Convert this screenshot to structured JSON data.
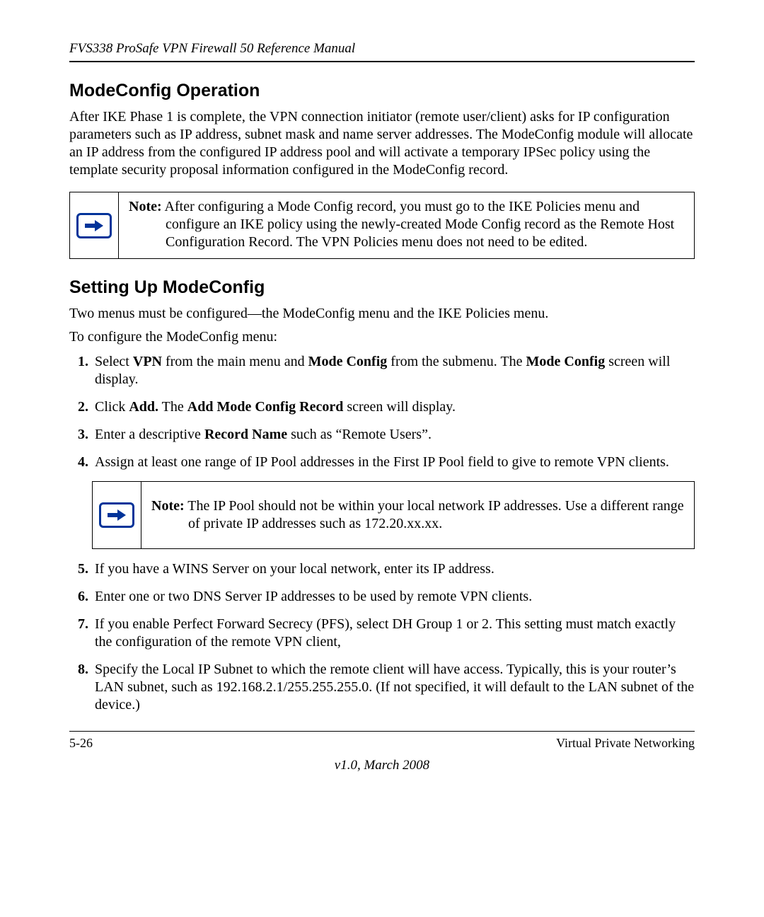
{
  "header": {
    "running_title": "FVS338 ProSafe VPN Firewall 50 Reference Manual"
  },
  "section1": {
    "heading": "ModeConfig Operation",
    "paragraph": "After IKE Phase 1 is complete, the VPN connection initiator (remote user/client) asks for IP configuration parameters such as IP address, subnet mask and name server addresses. The ModeConfig module will allocate an IP address from the configured IP address pool and will activate a temporary IPSec policy using the template security proposal information configured in the ModeConfig record."
  },
  "note1": {
    "label": "Note:",
    "text": "After configuring a Mode Config record, you must go to the IKE Policies menu and configure an IKE policy using the newly-created Mode Config record as the Remote Host Configuration Record. The VPN Policies menu does not need to be edited."
  },
  "section2": {
    "heading": "Setting Up ModeConfig",
    "intro1": "Two menus must be configured—the ModeConfig menu and the IKE Policies menu.",
    "intro2": "To configure the ModeConfig menu:"
  },
  "steps_part1": {
    "s1_pre": "Select ",
    "s1_b1": "VPN",
    "s1_mid1": " from the main menu and ",
    "s1_b2": "Mode Config",
    "s1_mid2": " from the submenu. The ",
    "s1_b3": "Mode Config",
    "s1_post": " screen will display.",
    "s2_pre": "Click ",
    "s2_b1": "Add.",
    "s2_mid": " The ",
    "s2_b2": "Add Mode Config Record",
    "s2_post": " screen will display.",
    "s3_pre": "Enter a descriptive ",
    "s3_b1": "Record Name",
    "s3_post": " such as “Remote Users”.",
    "s4": "Assign at least one range of IP Pool addresses in the First IP Pool field to give to remote VPN clients."
  },
  "note2": {
    "label": "Note:",
    "text": "The IP Pool should not be within your local network IP addresses. Use a different range of private IP addresses such as 172.20.xx.xx."
  },
  "steps_part2": {
    "s5": "If you have a WINS Server on your local network, enter its IP address.",
    "s6": "Enter one or two DNS Server IP addresses to be used by remote VPN clients.",
    "s7": "If you enable Perfect Forward Secrecy (PFS), select DH Group 1 or 2. This setting must match exactly the configuration of the remote VPN client,",
    "s8": "Specify the Local IP Subnet to which the remote client will have access. Typically, this is your router’s LAN subnet, such as 192.168.2.1/255.255.255.0. (If not specified, it will default to the LAN subnet of the device.)"
  },
  "footer": {
    "page_num": "5-26",
    "chapter": "Virtual Private Networking",
    "version": "v1.0, March 2008"
  }
}
